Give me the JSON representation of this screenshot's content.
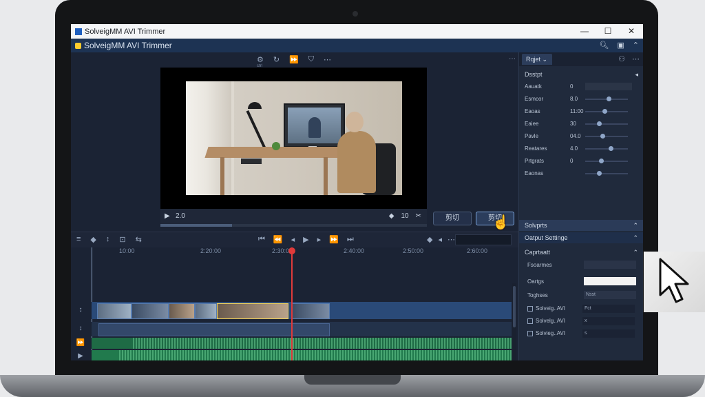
{
  "window": {
    "title": "SolveigMM AVI Trimmer",
    "controls": {
      "minimize": "—",
      "maximize": "☐",
      "close": "✕"
    }
  },
  "header": {
    "title": "SolveigMM AVI Trimmer",
    "icons": [
      "search-icon",
      "window-icon",
      "chevron-up-icon"
    ]
  },
  "transport_top": {
    "icons": [
      "speed-icon",
      "loop-icon",
      "forward-icon",
      "marker-icon",
      "more-icon"
    ],
    "glyphs": [
      "⚙",
      "↻",
      "⏩",
      "⛉",
      "⋯"
    ],
    "sub_label": "ctrl"
  },
  "preview": {
    "time": "2.0",
    "play_glyph": "▶",
    "right_controls": [
      "◆",
      "10",
      "✂"
    ],
    "progress_percent": 27
  },
  "buttons": {
    "left": "剪切",
    "right": "剪切"
  },
  "timeline_toolbar": {
    "left_glyphs": [
      "≡",
      "◆",
      "↕",
      "⊡",
      "⇆"
    ],
    "mid_glyphs": [
      "⏮",
      "⏪",
      "◂",
      "▶",
      "▸",
      "⏩",
      "⏭"
    ],
    "right_glyphs": [
      "◆",
      "◂",
      "⋯"
    ]
  },
  "ruler": {
    "labels": [
      "10:00",
      "2:20:00",
      "2:30:00",
      "2:40:00",
      "2:50:00",
      "2:60:00"
    ]
  },
  "tracks": {
    "video1_icon": "↕",
    "video2_icon": "↕",
    "audio1_icon": "⏩",
    "audio2_icon": "▶"
  },
  "right_panel": {
    "tab_label": "Rqjet",
    "tab_icons": [
      "person-icon",
      "more-icon"
    ],
    "section1_title": "Dsstpt",
    "props": [
      {
        "label": "Aauatk",
        "value": "0"
      },
      {
        "label": "Esmcor",
        "value": "8.0",
        "slider": 0.55
      },
      {
        "label": "Eaoas",
        "value": "11:00",
        "slider": 0.45
      },
      {
        "label": "Eaiee",
        "value": "30",
        "slider": 0.3
      },
      {
        "label": "Pavle",
        "value": "04.0",
        "slider": 0.4
      },
      {
        "label": "Reatares",
        "value": "4.0",
        "slider": 0.6
      },
      {
        "label": "Prtgrats",
        "value": "0",
        "slider": 0.35
      },
      {
        "label": "Eaonas",
        "value": "",
        "slider": 0.3
      }
    ],
    "subsection": "Solvprts",
    "output_settings": "Oatput Settinge",
    "output": {
      "group": "Caprtaatt",
      "rows": [
        {
          "label": "Fsoarmes"
        },
        {
          "label": "Oartgs"
        },
        {
          "label": "Toghses"
        }
      ],
      "files": [
        {
          "name": "Solveig..AVI",
          "cell": "Fct"
        },
        {
          "name": "Solvelg..AVI",
          "cell": "x"
        },
        {
          "name": "Solvieg..AVI",
          "cell": "s"
        }
      ]
    },
    "toghses_value": "Nsst"
  },
  "colors": {
    "accent": "#2a4a78",
    "audio": "#217a4d",
    "playhead": "#e03a3a",
    "selection": "#f2d35a"
  }
}
